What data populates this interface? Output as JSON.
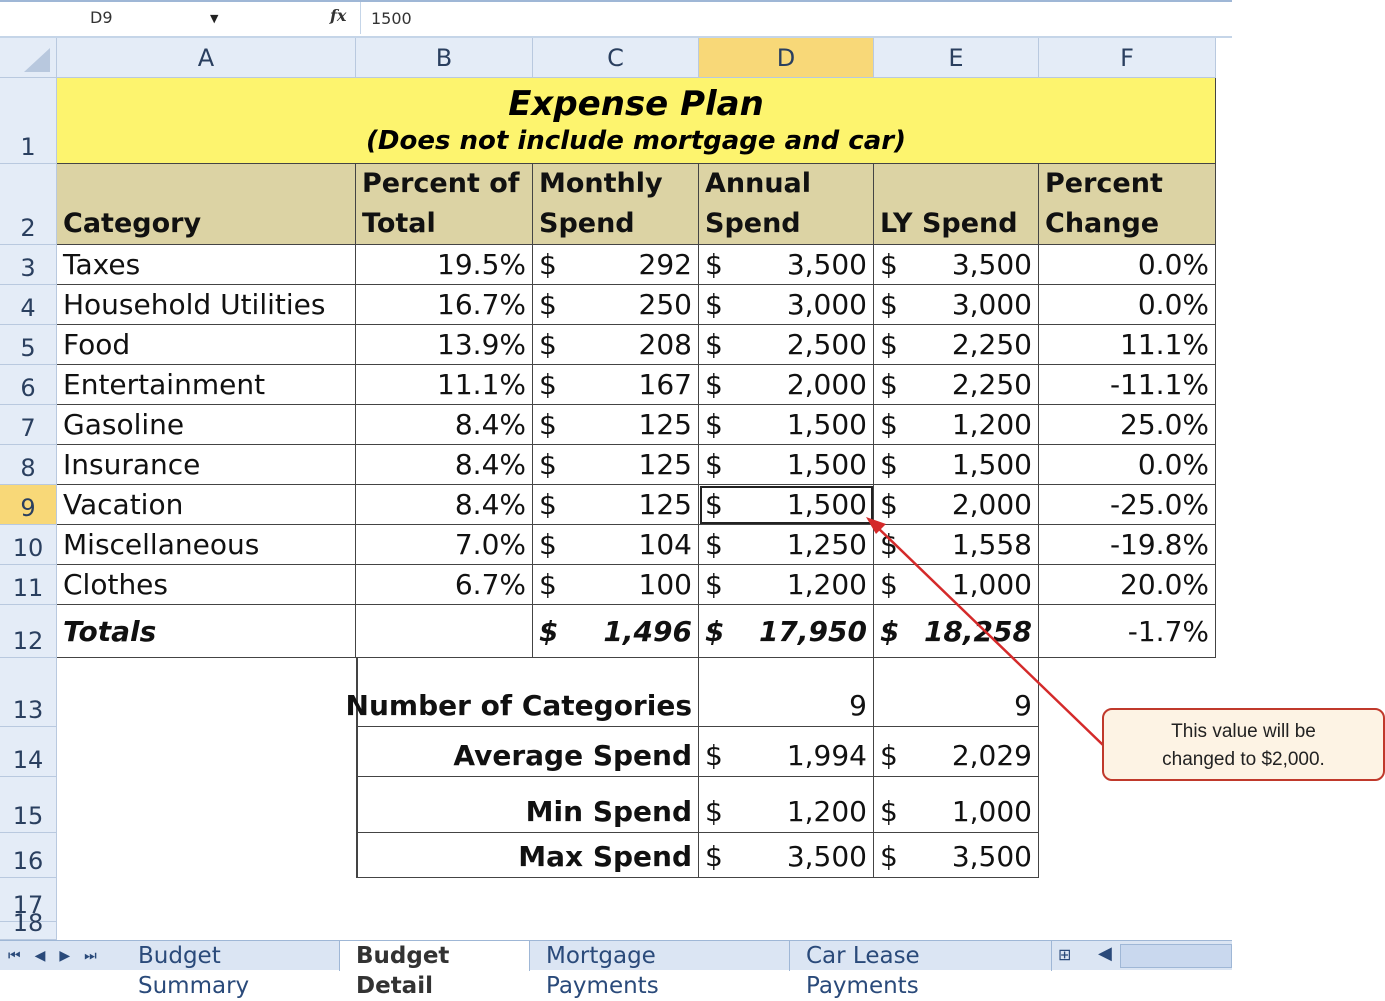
{
  "formula_bar": {
    "name_box": "D9",
    "fx_label": "fx",
    "formula": "1500"
  },
  "columns": [
    "A",
    "B",
    "C",
    "D",
    "E",
    "F"
  ],
  "selected_column": "D",
  "row_numbers": [
    "1",
    "2",
    "3",
    "4",
    "5",
    "6",
    "7",
    "8",
    "9",
    "10",
    "11",
    "12",
    "13",
    "14",
    "15",
    "16",
    "17",
    "18"
  ],
  "selected_row": "9",
  "title": {
    "main": "Expense Plan",
    "sub": "(Does not include mortgage and car)"
  },
  "headers": {
    "category": "Category",
    "pct": [
      "Percent of",
      "Total"
    ],
    "monthly": [
      "Monthly",
      "Spend"
    ],
    "annual": [
      "Annual",
      "Spend"
    ],
    "ly": [
      "",
      "LY Spend"
    ],
    "change": [
      "Percent",
      "Change"
    ]
  },
  "rows": [
    {
      "category": "Taxes",
      "pct": "19.5%",
      "monthly": "292",
      "annual": "3,500",
      "ly": "3,500",
      "change": "0.0%"
    },
    {
      "category": "Household Utilities",
      "pct": "16.7%",
      "monthly": "250",
      "annual": "3,000",
      "ly": "3,000",
      "change": "0.0%"
    },
    {
      "category": "Food",
      "pct": "13.9%",
      "monthly": "208",
      "annual": "2,500",
      "ly": "2,250",
      "change": "11.1%"
    },
    {
      "category": "Entertainment",
      "pct": "11.1%",
      "monthly": "167",
      "annual": "2,000",
      "ly": "2,250",
      "change": "-11.1%"
    },
    {
      "category": "Gasoline",
      "pct": "8.4%",
      "monthly": "125",
      "annual": "1,500",
      "ly": "1,200",
      "change": "25.0%"
    },
    {
      "category": "Insurance",
      "pct": "8.4%",
      "monthly": "125",
      "annual": "1,500",
      "ly": "1,500",
      "change": "0.0%"
    },
    {
      "category": "Vacation",
      "pct": "8.4%",
      "monthly": "125",
      "annual": "1,500",
      "ly": "2,000",
      "change": "-25.0%"
    },
    {
      "category": "Miscellaneous",
      "pct": "7.0%",
      "monthly": "104",
      "annual": "1,250",
      "ly": "1,558",
      "change": "-19.8%"
    },
    {
      "category": "Clothes",
      "pct": "6.7%",
      "monthly": "100",
      "annual": "1,200",
      "ly": "1,000",
      "change": "20.0%"
    }
  ],
  "currency": "$",
  "totals": {
    "label": "Totals",
    "monthly": "1,496",
    "annual": "17,950",
    "ly": "18,258",
    "change": "-1.7%"
  },
  "stats": [
    {
      "label": "Number of Categories",
      "annual": "9",
      "ly": "9",
      "currency": false
    },
    {
      "label": "Average Spend",
      "annual": "1,994",
      "ly": "2,029",
      "currency": true
    },
    {
      "label": "Min Spend",
      "annual": "1,200",
      "ly": "1,000",
      "currency": true
    },
    {
      "label": "Max Spend",
      "annual": "3,500",
      "ly": "3,500",
      "currency": true
    }
  ],
  "sheet_tabs": [
    {
      "label": "Budget Summary",
      "active": false
    },
    {
      "label": "Budget Detail",
      "active": true
    },
    {
      "label": "Mortgage Payments",
      "active": false
    },
    {
      "label": "Car Lease Payments",
      "active": false
    }
  ],
  "callout": {
    "line1": "This value will be",
    "line2": "changed to $2,000.",
    "border_color": "#c0392b"
  }
}
